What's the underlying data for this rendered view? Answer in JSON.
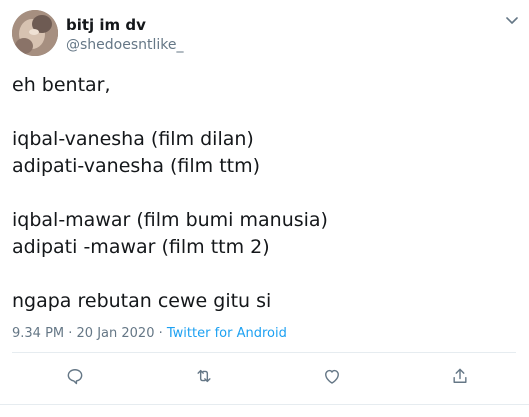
{
  "tweet": {
    "author": {
      "display_name": "bitj im dv",
      "handle": "@shedoesntlike_"
    },
    "text_lines": [
      "eh bentar,",
      "",
      "iqbal-vanesha (film dilan)",
      "adipati-vanesha (film ttm)",
      "",
      "iqbal-mawar (film bumi manusia)",
      "adipati -mawar (film ttm 2)",
      "",
      "ngapa rebutan cewe gitu si"
    ],
    "timestamp": "9.34 PM · 20 Jan 2020",
    "separator": " · ",
    "source": "Twitter for Android"
  },
  "actions": {
    "reply_icon": "reply-icon",
    "retweet_icon": "retweet-icon",
    "like_icon": "heart-icon",
    "share_icon": "share-icon"
  },
  "colors": {
    "text": "#14171a",
    "secondary": "#657786",
    "accent": "#1da1f2",
    "divider": "#e6ecf0"
  }
}
